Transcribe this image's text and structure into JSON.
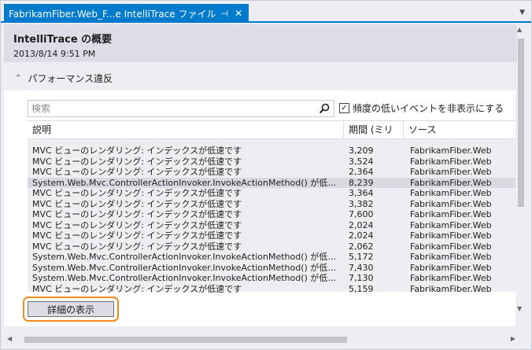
{
  "tab": {
    "title": "FabrikamFiber.Web_F...e IntelliTrace ファイル",
    "pin_icon": "pin-icon",
    "close_icon": "close-icon",
    "pin_glyph": "⊣",
    "close_glyph": "✕",
    "dropdown_glyph": "▼"
  },
  "summary": {
    "title": "IntelliTrace の概要",
    "date": "2013/8/14 9:51 PM"
  },
  "section": {
    "title": "パフォーマンス違反",
    "expanded": true,
    "chevron_glyph": "⌃"
  },
  "search": {
    "placeholder": "検索",
    "value": ""
  },
  "filter": {
    "label": "頻度の低いイベントを非表示にする",
    "checked": true,
    "check_glyph": "✓"
  },
  "table": {
    "columns": {
      "description": "説明",
      "duration": "期間 (ミリ秒)",
      "source": "ソース"
    },
    "rows": [
      {
        "description": "MVC ビューのレンダリング: インデックスが低速です",
        "duration": "3,209",
        "source": "FabrikamFiber.Web",
        "selected": false
      },
      {
        "description": "MVC ビューのレンダリング: インデックスが低速です",
        "duration": "3,524",
        "source": "FabrikamFiber.Web",
        "selected": false
      },
      {
        "description": "MVC ビューのレンダリング: インデックスが低速です",
        "duration": "2,364",
        "source": "FabrikamFiber.Web",
        "selected": false
      },
      {
        "description": "System.Web.Mvc.ControllerActionInvoker.InvokeActionMethod() が低速です...",
        "duration": "8,239",
        "source": "FabrikamFiber.Web",
        "selected": true
      },
      {
        "description": "MVC ビューのレンダリング: インデックスが低速です",
        "duration": "3,364",
        "source": "FabrikamFiber.Web",
        "selected": false
      },
      {
        "description": "MVC ビューのレンダリング: インデックスが低速です",
        "duration": "3,382",
        "source": "FabrikamFiber.Web",
        "selected": false
      },
      {
        "description": "MVC ビューのレンダリング: インデックスが低速です",
        "duration": "7,600",
        "source": "FabrikamFiber.Web",
        "selected": false
      },
      {
        "description": "MVC ビューのレンダリング: インデックスが低速です",
        "duration": "2,024",
        "source": "FabrikamFiber.Web",
        "selected": false
      },
      {
        "description": "MVC ビューのレンダリング: インデックスが低速です",
        "duration": "2,024",
        "source": "FabrikamFiber.Web",
        "selected": false
      },
      {
        "description": "MVC ビューのレンダリング: インデックスが低速です",
        "duration": "2,062",
        "source": "FabrikamFiber.Web",
        "selected": false
      },
      {
        "description": "System.Web.Mvc.ControllerActionInvoker.InvokeActionMethod() が低速です...",
        "duration": "5,172",
        "source": "FabrikamFiber.Web",
        "selected": false
      },
      {
        "description": "System.Web.Mvc.ControllerActionInvoker.InvokeActionMethod() が低速です...",
        "duration": "7,430",
        "source": "FabrikamFiber.Web",
        "selected": false
      },
      {
        "description": "System.Web.Mvc.ControllerActionInvoker.InvokeActionMethod() が低速です...",
        "duration": "7,130",
        "source": "FabrikamFiber.Web",
        "selected": false
      },
      {
        "description": "MVC ビューのレンダリング: インデックスが低速です",
        "duration": "5,159",
        "source": "FabrikamFiber.Web",
        "selected": false
      }
    ]
  },
  "details_button": {
    "label": "詳細の表示",
    "highlight_color": "#f28c1a"
  },
  "colors": {
    "tab_accent": "#007acc",
    "selected_row": "#d9d9e3"
  },
  "icons": {
    "search": "search-icon",
    "scroll_up": "chevron-up-icon",
    "scroll_down": "chevron-down-icon",
    "scroll_left": "chevron-left-icon",
    "scroll_right": "chevron-right-icon",
    "up_glyph": "▲",
    "down_glyph": "▼",
    "left_glyph": "◀",
    "right_glyph": "▶"
  }
}
